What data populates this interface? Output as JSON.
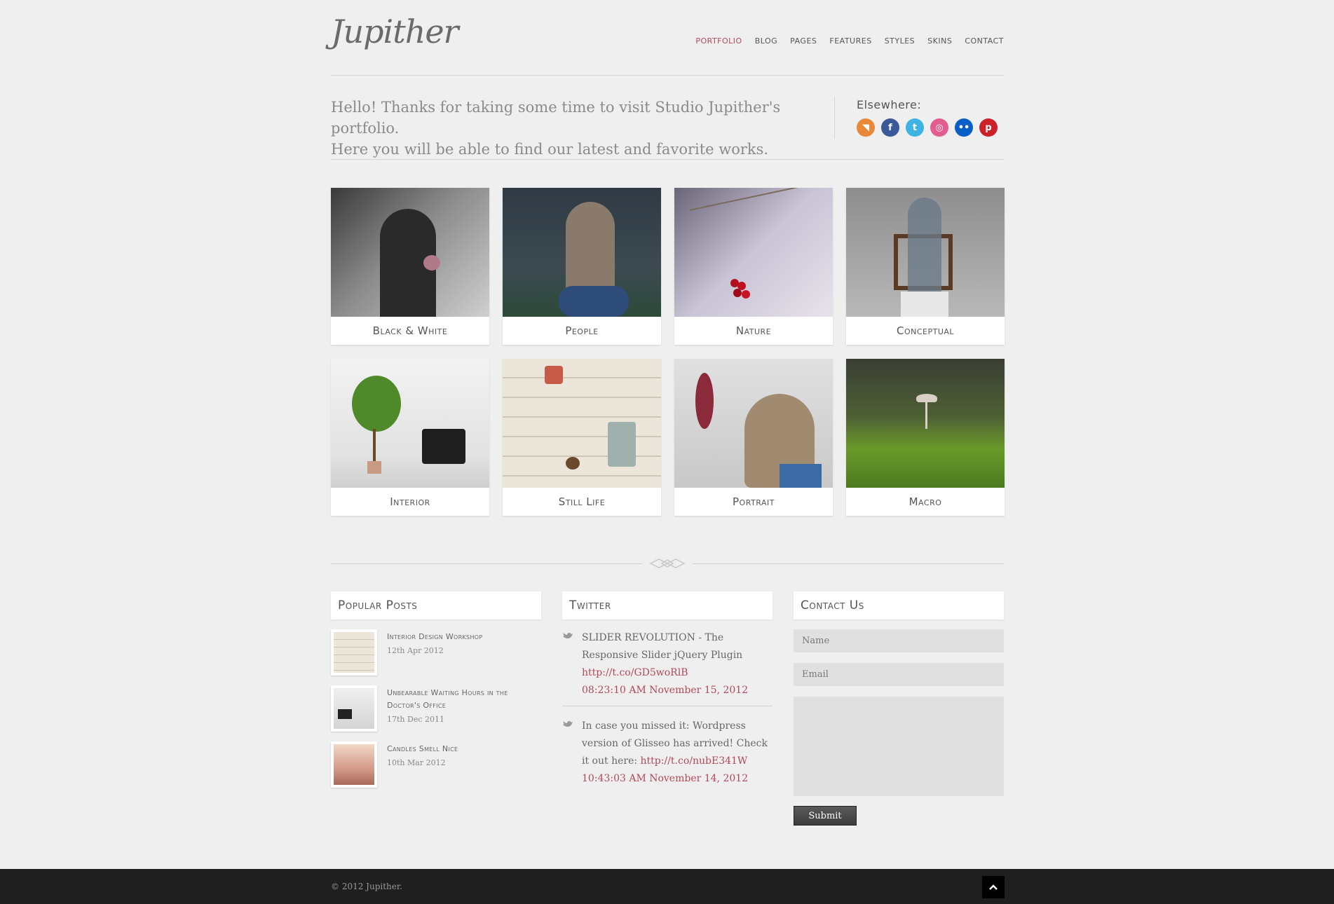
{
  "brand": {
    "logo": "Jupither"
  },
  "nav": [
    {
      "label": "Portfolio",
      "active": true
    },
    {
      "label": "Blog",
      "active": false
    },
    {
      "label": "Pages",
      "active": false
    },
    {
      "label": "Features",
      "active": false
    },
    {
      "label": "Styles",
      "active": false
    },
    {
      "label": "Skins",
      "active": false
    },
    {
      "label": "Contact",
      "active": false
    }
  ],
  "intro": {
    "line1": "Hello! Thanks for taking some time to visit Studio Jupither's portfolio.",
    "line2": "Here you will be able to find our latest and favorite works."
  },
  "elsewhere": {
    "title": "Elsewhere:",
    "icons": [
      {
        "name": "rss-icon",
        "glyph": "◥",
        "color": "#e8893a"
      },
      {
        "name": "facebook-icon",
        "glyph": "f",
        "color": "#3b5998"
      },
      {
        "name": "twitter-icon",
        "glyph": "t",
        "color": "#3fb4e4"
      },
      {
        "name": "dribbble-icon",
        "glyph": "◎",
        "color": "#e45c8f"
      },
      {
        "name": "flickr-icon",
        "glyph": "••",
        "color": "#0a5ec8"
      },
      {
        "name": "pinterest-icon",
        "glyph": "p",
        "color": "#cc2127"
      }
    ]
  },
  "gallery": [
    {
      "caption": "Black & White"
    },
    {
      "caption": "People"
    },
    {
      "caption": "Nature"
    },
    {
      "caption": "Conceptual"
    },
    {
      "caption": "Interior"
    },
    {
      "caption": "Still Life"
    },
    {
      "caption": "Portrait"
    },
    {
      "caption": "Macro"
    }
  ],
  "popular_posts": {
    "title": "Popular Posts",
    "items": [
      {
        "title": "Interior Design Workshop",
        "date": "12th Apr 2012"
      },
      {
        "title": "Unbearable Waiting Hours in the Doctor's Office",
        "date": "17th Dec 2011"
      },
      {
        "title": "Candles Smell Nice",
        "date": "10th Mar 2012"
      }
    ]
  },
  "twitter": {
    "title": "Twitter",
    "tweets": [
      {
        "text": "SLIDER REVOLUTION - The Responsive Slider jQuery Plugin ",
        "link": "http://t.co/GD5woRlB",
        "time": "08:23:10 AM November 15, 2012"
      },
      {
        "text": "In case you missed it: Wordpress version of Glisseo has arrived! Check it out here: ",
        "link": "http://t.co/nubE341W",
        "time": "10:43:03 AM November 14, 2012"
      }
    ]
  },
  "contact": {
    "title": "Contact Us",
    "name_placeholder": "Name",
    "email_placeholder": "Email",
    "submit_label": "Submit"
  },
  "footer": {
    "copyright": "© 2012 Jupither."
  }
}
